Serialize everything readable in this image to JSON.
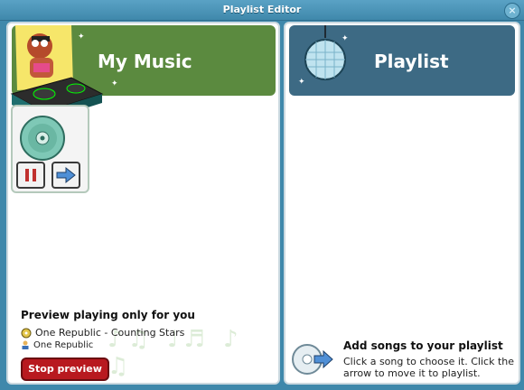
{
  "window": {
    "title": "Playlist Editor"
  },
  "my_music": {
    "title": "My Music",
    "preview_title": "Preview playing only for you",
    "song": "One Republic - Counting Stars",
    "artist": "One Republic",
    "stop_button": "Stop preview"
  },
  "playlist": {
    "title": "Playlist",
    "hint_title": "Add songs to your playlist",
    "hint_text": "Click a song to choose it. Click the arrow to move it to playlist."
  },
  "icons": {
    "close": "close-icon",
    "pause": "pause-icon",
    "arrow": "arrow-right-icon",
    "cd": "cd-icon",
    "disco": "disco-ball-icon"
  },
  "colors": {
    "window_blue": "#3f88ab",
    "green_header": "#5b8a3f",
    "blue_header": "#3d6a84",
    "stop_red": "#b8191f"
  }
}
